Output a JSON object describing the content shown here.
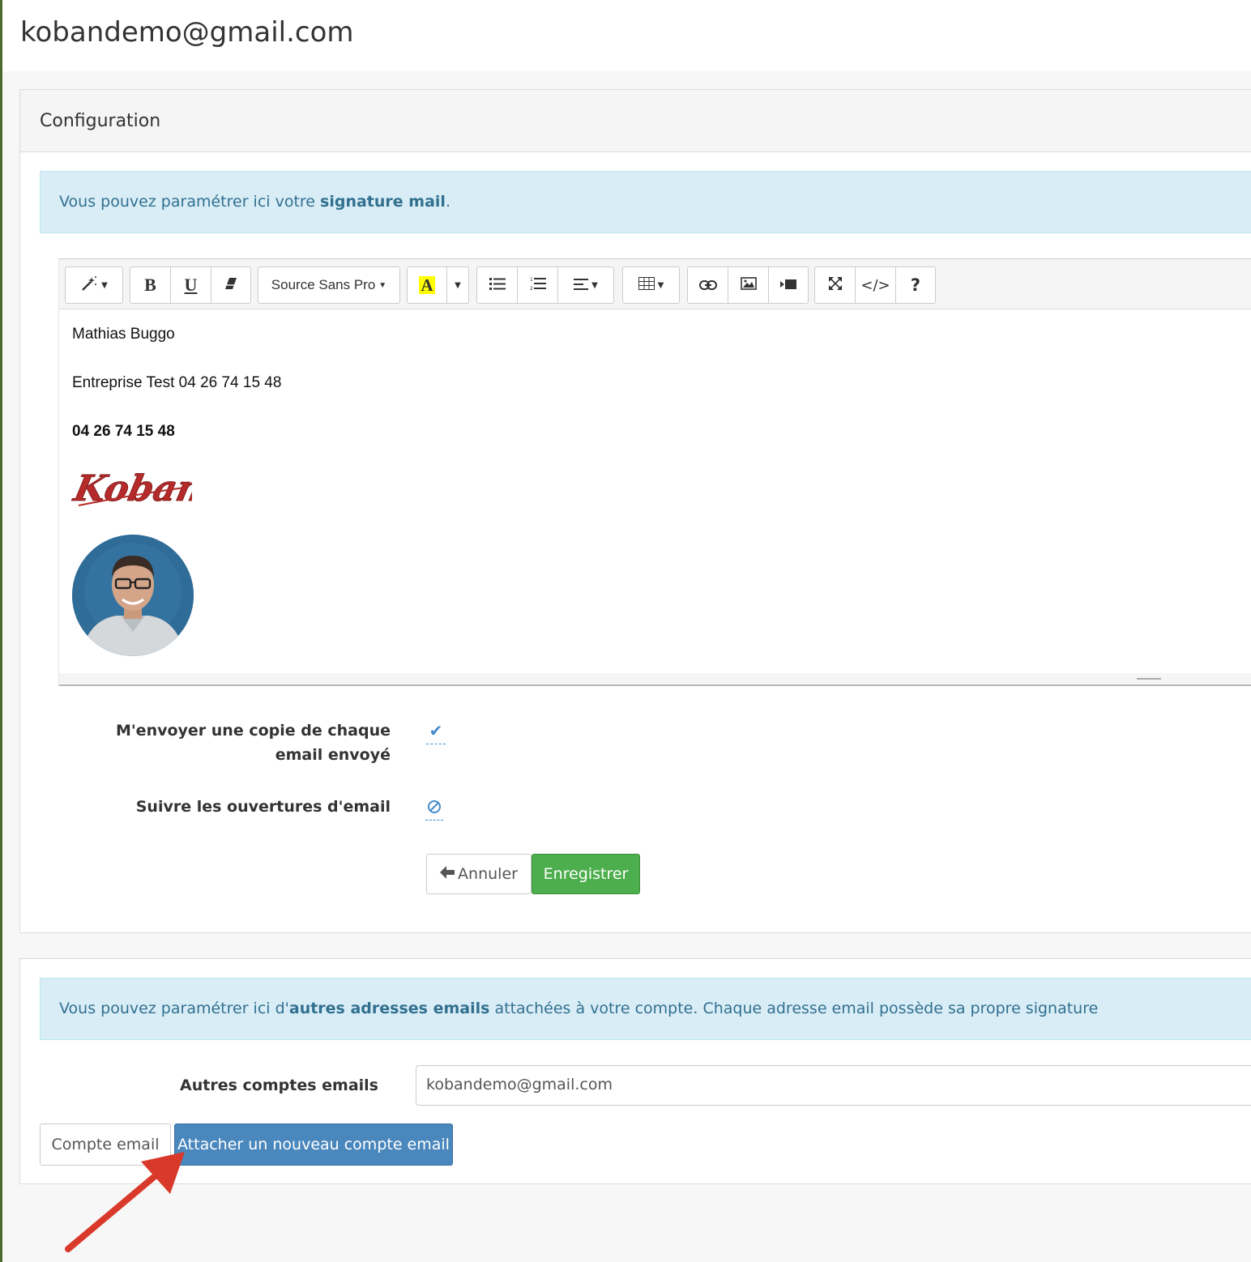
{
  "page": {
    "title": "kobandemo@gmail.com"
  },
  "config_panel": {
    "heading": "Configuration",
    "info": {
      "prefix": "Vous pouvez paramétrer ici votre ",
      "bold": "signature mail",
      "suffix": "."
    },
    "toolbar": {
      "font_name": "Source Sans Pro",
      "bold_label": "B",
      "underline_label": "U",
      "highlight_label": "A",
      "code_label": "</>",
      "help_label": "?",
      "icons": [
        "magic-icon",
        "eraser-icon",
        "unordered-list-icon",
        "ordered-list-icon",
        "align-icon",
        "table-icon",
        "link-icon",
        "picture-icon",
        "video-icon",
        "fullscreen-icon",
        "code-view-icon",
        "help-icon"
      ]
    },
    "signature": {
      "line1": "Mathias Buggo",
      "line2": "Entreprise Test 04 26 74 15 48",
      "line3": "04 26 74 15 48",
      "logo_text": "Koban"
    },
    "settings": {
      "copy_label": "M'envoyer une copie de chaque email envoyé",
      "copy_state": "enabled",
      "track_label": "Suivre les ouvertures d'email",
      "track_state": "disabled"
    },
    "buttons": {
      "cancel": "Annuler",
      "save": "Enregistrer"
    }
  },
  "accounts_panel": {
    "info": {
      "prefix": "Vous pouvez paramétrer ici d'",
      "bold": "autres adresses emails",
      "suffix": " attachées à votre compte. Chaque adresse email possède sa propre signature"
    },
    "field_label": "Autres comptes emails",
    "field_value": "kobandemo@gmail.com",
    "buttons": {
      "account": "Compte email",
      "attach": "Attacher un nouveau compte email"
    }
  },
  "colors": {
    "info_bg": "#d9edf7",
    "info_text": "#31708f",
    "success": "#4cae4c",
    "primary": "#4a87bd",
    "annotation_arrow": "#d9392b"
  }
}
